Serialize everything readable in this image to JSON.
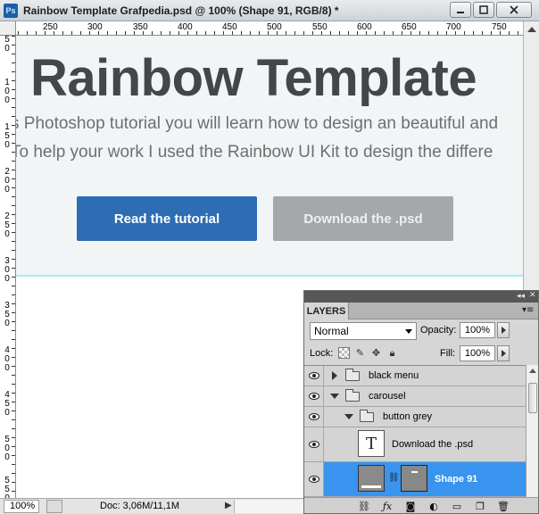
{
  "window": {
    "app_icon": "Ps",
    "title": "Rainbow Template Grafpedia.psd @ 100% (Shape 91, RGB/8) *"
  },
  "ruler": {
    "top_labels": [
      "250",
      "300",
      "350",
      "400",
      "450",
      "500",
      "550",
      "600",
      "650",
      "700",
      "750"
    ],
    "left_labels": [
      "50",
      "100",
      "150",
      "200",
      "250",
      "300",
      "350",
      "400",
      "450",
      "500",
      "550"
    ]
  },
  "canvas": {
    "hero_title": "Rainbow Template",
    "hero_line_1": "s Photoshop tutorial you will learn how to design an beautiful and",
    "hero_line_2": "To help your work I used the Rainbow UI Kit to design the differe",
    "button_primary": "Read the tutorial",
    "button_secondary": "Download the .psd",
    "colors": {
      "hero_bg": "#f2f5f6",
      "title": "#444647",
      "body_text": "#6d6f70",
      "primary": "#2d6db4",
      "secondary": "#a4a8ab",
      "guide": "#9ef0f3"
    }
  },
  "status": {
    "zoom": "100%",
    "doc": "Doc: 3,06M/11,1M",
    "arrow": "▶"
  },
  "layers_panel": {
    "tab": "LAYERS",
    "panel_menu_icon": "menu-icon",
    "blend_mode": "Normal",
    "opacity_label": "Opacity:",
    "opacity_value": "100%",
    "lock_label": "Lock:",
    "fill_label": "Fill:",
    "fill_value": "100%",
    "layers": [
      {
        "name": "black menu",
        "type": "group",
        "expanded": false,
        "indent": 0
      },
      {
        "name": "carousel",
        "type": "group",
        "expanded": true,
        "indent": 0
      },
      {
        "name": "button grey",
        "type": "group",
        "expanded": true,
        "indent": 1
      },
      {
        "name": "Download the .psd",
        "type": "text",
        "thumb": "T",
        "indent": 2
      },
      {
        "name": "Shape 91",
        "type": "shape",
        "selected": true,
        "indent": 2
      }
    ],
    "selected_color": "#3894ef"
  }
}
